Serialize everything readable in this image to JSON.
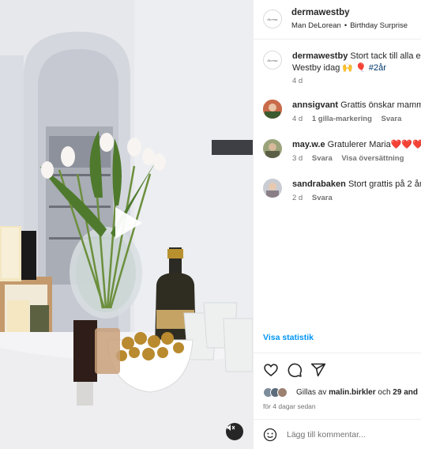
{
  "post": {
    "author": "dermawestby",
    "location": "Man DeLorean",
    "audio": "Birthday Surprise",
    "separator": "•"
  },
  "caption": {
    "username": "dermawestby",
    "text_line1": "Stort tack till alla er",
    "text_line2": "Westby idag",
    "emojis": "🙌 🎈",
    "hashtag": "#2år",
    "time": "4 d"
  },
  "comments": [
    {
      "username": "annsigvant",
      "text": "Grattis önskar mamm",
      "time": "4 d",
      "likes": "1 gilla-markering",
      "reply": "Svara"
    },
    {
      "username": "may.w.e",
      "text": "Gratulerer Maria",
      "hearts": "❤️❤️❤️",
      "time": "3 d",
      "reply": "Svara",
      "translation": "Visa översättning"
    },
    {
      "username": "sandrabaken",
      "text": "Stort grattis på 2 år",
      "time": "2 d",
      "reply": "Svara"
    }
  ],
  "stats_link": "Visa statistik",
  "likes": {
    "prefix": "Gillas av",
    "user": "malin.birkler",
    "conj": "och",
    "others": "29 and"
  },
  "posted_ago": "för 4 dagar sedan",
  "add_comment": {
    "placeholder": "Lägg till kommentar..."
  },
  "icons": {
    "like": "heart-icon",
    "comment": "comment-icon",
    "share": "share-icon",
    "emoji": "emoji-icon",
    "play": "play-icon",
    "mute": "muted-speaker-icon"
  },
  "colors": {
    "link_blue": "#0095f6",
    "hashtag": "#00376b",
    "meta_gray": "#737373",
    "text": "#262626"
  }
}
